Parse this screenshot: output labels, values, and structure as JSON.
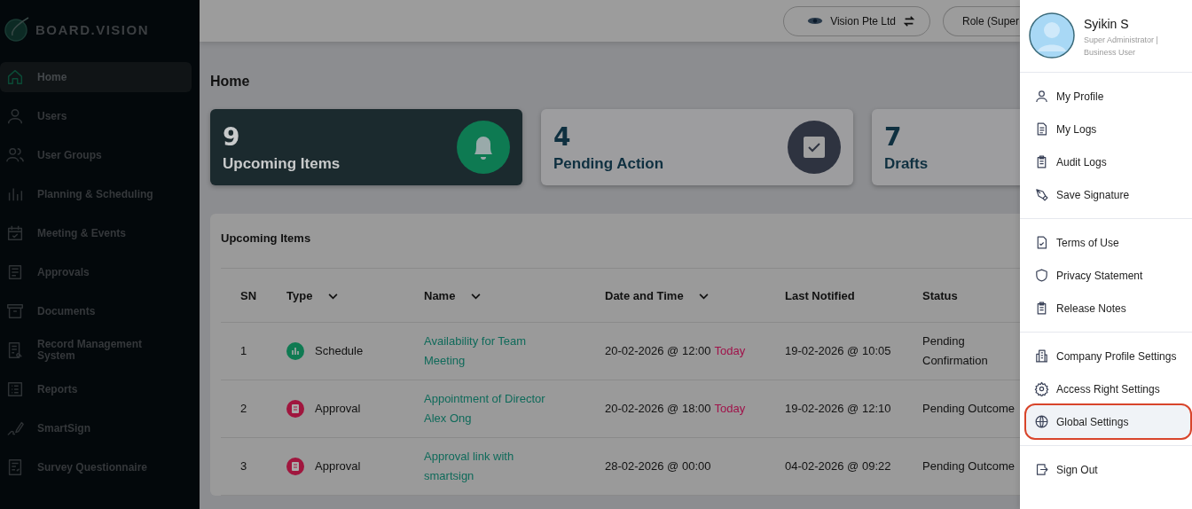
{
  "sidebar": {
    "logo": "BOARD.VISION",
    "items": [
      {
        "label": "Home",
        "selected": true
      },
      {
        "label": "Users",
        "selected": false
      },
      {
        "label": "User Groups",
        "selected": false
      },
      {
        "label": "Planning & Scheduling",
        "selected": false
      },
      {
        "label": "Meeting & Events",
        "selected": false
      },
      {
        "label": "Approvals",
        "selected": false
      },
      {
        "label": "Documents",
        "selected": false
      },
      {
        "label": "Record Management System",
        "selected": false
      },
      {
        "label": "Reports",
        "selected": false
      },
      {
        "label": "SmartSign",
        "selected": false
      },
      {
        "label": "Survey Questionnaire",
        "selected": false
      }
    ]
  },
  "top_bar": {
    "company": "Vision Pte Ltd",
    "role": "Role (Super"
  },
  "page_title": "Home",
  "summary_cards": [
    {
      "count": "9",
      "label": "Upcoming Items",
      "selected": true
    },
    {
      "count": "4",
      "label": "Pending Action",
      "selected": false
    },
    {
      "count": "7",
      "label": "Drafts",
      "selected": false
    }
  ],
  "table": {
    "title": "Upcoming Items",
    "columns": [
      {
        "label": "SN",
        "sortable": false
      },
      {
        "label": "Type",
        "sortable": true
      },
      {
        "label": "Name",
        "sortable": true
      },
      {
        "label": "Date and Time",
        "sortable": true
      },
      {
        "label": "Last Notified",
        "sortable": false
      },
      {
        "label": "Status",
        "sortable": false
      }
    ],
    "rows": [
      {
        "sn": "1",
        "type": "Schedule",
        "kind": "schedule",
        "name": "Availability for Team Meeting",
        "date": "20-02-2026 @ 12:00",
        "today": "Today",
        "notified": "19-02-2026 @ 10:05",
        "status": "Pending Confirmation"
      },
      {
        "sn": "2",
        "type": "Approval",
        "kind": "approval",
        "name": "Appointment of Director Alex Ong",
        "date": "20-02-2026 @ 18:00",
        "today": "Today",
        "notified": "19-02-2026 @ 12:10",
        "status": "Pending Outcome"
      },
      {
        "sn": "3",
        "type": "Approval",
        "kind": "approval",
        "name": "Approval link with smartsign",
        "date": "28-02-2026 @ 00:00",
        "notified": "04-02-2026 @ 09:22",
        "status": "Pending Outcome"
      }
    ]
  },
  "user_menu": {
    "name": "Syikin S",
    "role": "Super Administrator | Business User",
    "groups": [
      [
        {
          "label": "My Profile",
          "selected": false
        },
        {
          "label": "My Logs",
          "selected": false
        },
        {
          "label": "Audit Logs",
          "selected": false
        },
        {
          "label": "Save Signature",
          "selected": false
        }
      ],
      [
        {
          "label": "Terms of Use",
          "selected": false
        },
        {
          "label": "Privacy Statement",
          "selected": false
        },
        {
          "label": "Release Notes",
          "selected": false
        }
      ],
      [
        {
          "label": "Company Profile Settings",
          "selected": false
        },
        {
          "label": "Access Right Settings",
          "selected": false
        },
        {
          "label": "Global Settings",
          "selected": true
        }
      ],
      [
        {
          "label": "Sign Out",
          "selected": false
        }
      ]
    ]
  }
}
